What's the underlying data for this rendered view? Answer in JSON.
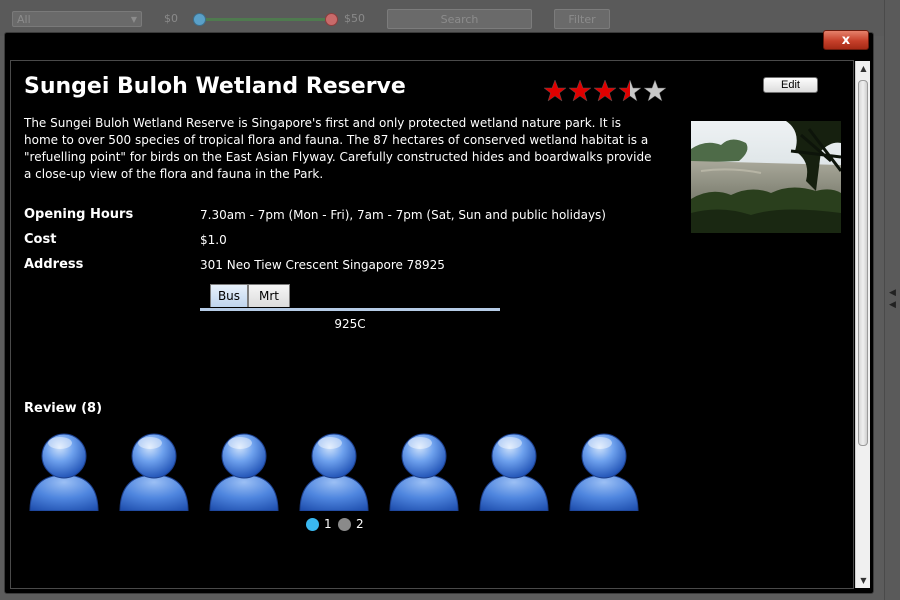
{
  "toolbar": {
    "category_value": "All",
    "price_min": "$0",
    "price_max": "$50",
    "search_label": "Search",
    "filter_label": "Filter",
    "colors": {
      "knob_min": "#5aa0c8",
      "knob_max": "#c86a6a"
    }
  },
  "dialog": {
    "close_label": "x",
    "title": "Sungei Buloh Wetland Reserve",
    "rating": 3.5,
    "rating_max": 5,
    "edit_label": "Edit",
    "description": "The Sungei Buloh Wetland Reserve is Singapore's first and only protected wetland nature park. It is home to over 500 species of tropical flora and fauna. The 87 hectares of conserved wetland habitat is a \"refuelling point\" for birds on the East Asian Flyway. Carefully constructed hides and boardwalks provide a close-up view of the flora and fauna in the Park.",
    "info": {
      "hours_label": "Opening Hours",
      "hours_value": "7.30am - 7pm (Mon - Fri), 7am - 7pm (Sat, Sun and public holidays)",
      "cost_label": "Cost",
      "cost_value": "$1.0",
      "address_label": "Address",
      "address_value": "301 Neo Tiew Crescent Singapore 78925"
    },
    "transport": {
      "tabs": [
        "Bus",
        "Mrt"
      ],
      "active_tab": "Bus",
      "content": "925C"
    },
    "reviews": {
      "heading": "Review (8)",
      "visible_avatars": 7,
      "pages": [
        "1",
        "2"
      ],
      "current_page": "1"
    },
    "colors": {
      "star_on": "#e00000",
      "star_off": "#c8c8c8",
      "dot_active": "#3ab8f0",
      "dot_inactive": "#8a8a8a",
      "close_button": "#c6402a"
    }
  }
}
